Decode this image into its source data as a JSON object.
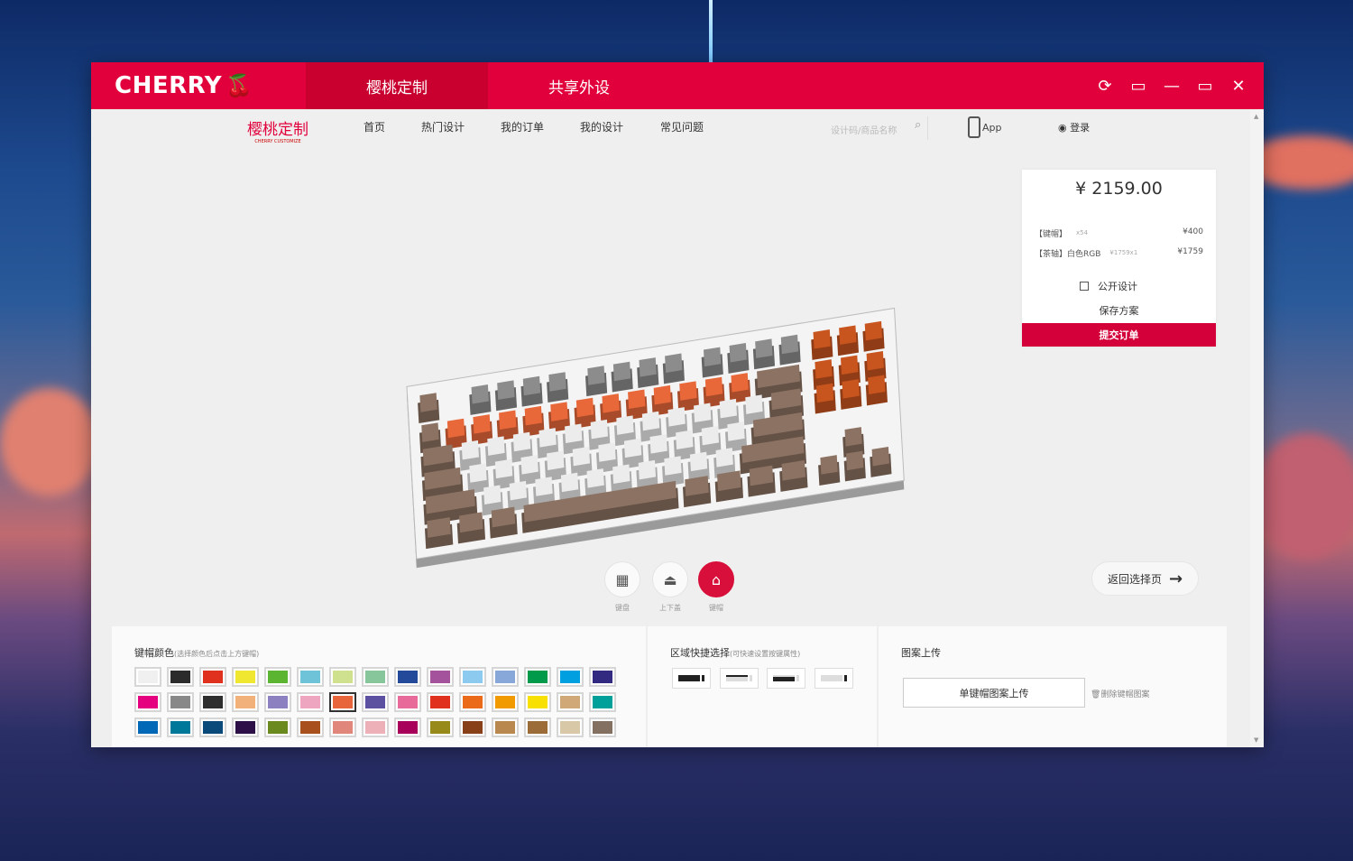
{
  "titlebar": {
    "logo": "CHERRY",
    "tabs": [
      {
        "label": "樱桃定制",
        "active": true
      },
      {
        "label": "共享外设",
        "active": false
      }
    ],
    "controls": [
      "refresh-icon",
      "feedback-icon",
      "minimize-icon",
      "maximize-icon",
      "close-icon"
    ],
    "accent": "#e2003c"
  },
  "nav": {
    "brand": "樱桃定制",
    "brand_sub": "CHERRY CUSTOMIZE",
    "items": [
      "首页",
      "热门设计",
      "我的订单",
      "我的设计",
      "常见问题"
    ],
    "search_placeholder": "设计码/商品名称",
    "app": "App",
    "login": "登录"
  },
  "price": {
    "total": "¥ 2159.00",
    "lines": [
      {
        "name": "【键帽】",
        "sub": "x54",
        "amount": "¥400"
      },
      {
        "name": "【茶轴】白色RGB",
        "sub": "¥1759x1",
        "amount": "¥1759"
      }
    ],
    "public_label": "公开设计",
    "public_checked": false,
    "save": "保存方案",
    "submit": "提交订单"
  },
  "keyboard": {
    "keycap_colors": {
      "function": "#8c8c8c",
      "number_row": "#e8683a",
      "alpha": "#ececec",
      "modifier": "#8c7262",
      "nav_cluster": "#c8541e",
      "case": "#f4f4f4"
    }
  },
  "modes": [
    {
      "label": "键盘",
      "icon": "keyboard-icon",
      "active": false
    },
    {
      "label": "上下盖",
      "icon": "case-icon",
      "active": false
    },
    {
      "label": "键帽",
      "icon": "keycap-icon",
      "active": true
    }
  ],
  "back_button": "返回选择页",
  "colors_panel": {
    "title": "键帽颜色",
    "hint": "(选择颜色后点击上方键帽)",
    "selected": "#e8643a",
    "swatches": [
      "#f0f0f0",
      "#2b2b2b",
      "#e0301e",
      "#f0e830",
      "#5cb531",
      "#6ec3d8",
      "#cfe08f",
      "#86c69a",
      "#234a9a",
      "#a4529c",
      "#8ccaf0",
      "#87a8d8",
      "#009a4a",
      "#00a0e0",
      "#312a80",
      "#e4007f",
      "#888888",
      "#2e2e2e",
      "#f2b07a",
      "#8c80c0",
      "#eea6c0",
      "#e8643a",
      "#5c50a0",
      "#e86a9a",
      "#e0301e",
      "#ea6a1a",
      "#f09a00",
      "#f8e000",
      "#d0a878",
      "#00a09a",
      "#0068b7",
      "#00789a",
      "#0a4a7a",
      "#2e1048",
      "#6a8a20",
      "#a8501e",
      "#e0867a",
      "#eeb0b8",
      "#a8005a",
      "#988a1a",
      "#884018",
      "#b8884e",
      "#9c6c38",
      "#d8c8a8",
      "#847060"
    ]
  },
  "quick_panel": {
    "title": "区域快捷选择",
    "hint": "(可快速设置按键属性)"
  },
  "upload_panel": {
    "title": "图案上传",
    "upload": "单键帽图案上传",
    "delete": "删除键帽图案"
  }
}
